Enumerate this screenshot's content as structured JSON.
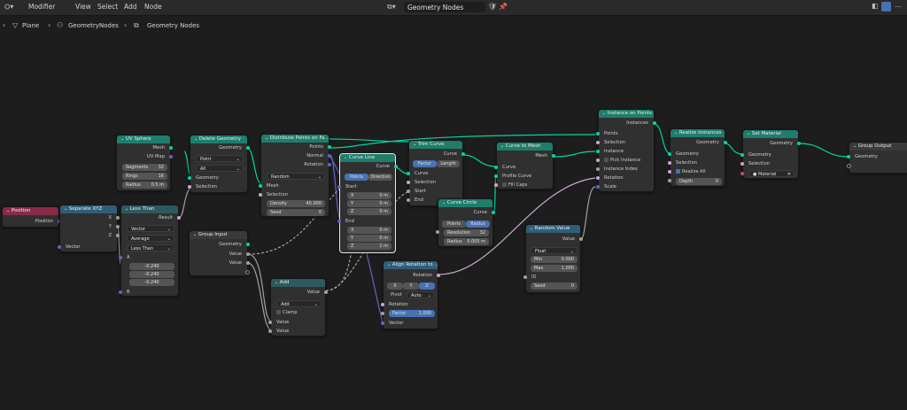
{
  "menu": {
    "modifier": "Modifier",
    "view": "View",
    "select": "Select",
    "add": "Add",
    "node": "Node"
  },
  "editor_title": "Geometry Nodes",
  "breadcrumb": {
    "plane": "Plane",
    "modifier": "GeometryNodes",
    "tree": "Geometry Nodes"
  },
  "nodes": {
    "position": {
      "title": "Position",
      "out": "Position"
    },
    "sepxyz": {
      "title": "Separate XYZ",
      "x": "X",
      "y": "Y",
      "z": "Z",
      "vector": "Vector"
    },
    "uvsphere": {
      "title": "UV Sphere",
      "mesh": "Mesh",
      "uvmap": "UV Map",
      "segments_l": "Segments",
      "segments": "32",
      "rings_l": "Rings",
      "rings": "16",
      "radius_l": "Radius",
      "radius": "0.5 m"
    },
    "lessthan": {
      "title": "Less Than",
      "result": "Result",
      "mode": "Vector",
      "op": "Average",
      "cmp": "Less Than",
      "a": "A",
      "a1": "-0.240",
      "a2": "-0.240",
      "a3": "-0.240",
      "b": "B"
    },
    "delgeo": {
      "title": "Delete Geometry",
      "geometry_out": "Geometry",
      "domain": "Point",
      "mode": "All",
      "geometry": "Geometry",
      "selection": "Selection"
    },
    "distribute": {
      "title": "Distribute Points on Fa…",
      "points": "Points",
      "normal": "Normal",
      "rotation": "Rotation",
      "method": "Random",
      "mesh": "Mesh",
      "selection": "Selection",
      "density_l": "Density",
      "density": "40.000",
      "seed_l": "Seed",
      "seed": "0"
    },
    "groupinput": {
      "title": "Group Input",
      "geometry": "Geometry",
      "value1": "Value",
      "value2": "Value"
    },
    "add": {
      "title": "Add",
      "value_out": "Value",
      "op": "Add",
      "clamp": "Clamp",
      "value1": "Value",
      "value2": "Value"
    },
    "curveline": {
      "title": "Curve Line",
      "curve": "Curve",
      "points": "Points",
      "direction": "Direction",
      "start": "Start",
      "sx": "X",
      "sxv": "0 m",
      "sy": "Y",
      "syv": "0 m",
      "sz": "Z",
      "szv": "0 m",
      "end": "End",
      "ex": "X",
      "exv": "0 m",
      "ey": "Y",
      "eyv": "0 m",
      "ez": "Z",
      "ezv": "1 m"
    },
    "trim": {
      "title": "Trim Curve",
      "curve_out": "Curve",
      "factor": "Factor",
      "length": "Length",
      "curve": "Curve",
      "selection": "Selection",
      "start": "Start",
      "end": "End"
    },
    "curvecircle": {
      "title": "Curve Circle",
      "curve": "Curve",
      "points": "Points",
      "radius_tab": "Radius",
      "res_l": "Resolution",
      "res": "32",
      "radius_l": "Radius",
      "radius": "0.005 m"
    },
    "curvetomesh": {
      "title": "Curve to Mesh",
      "mesh": "Mesh",
      "curve": "Curve",
      "profile": "Profile Curve",
      "fillcaps": "Fill Caps"
    },
    "align": {
      "title": "Align Rotation to …",
      "rotation_out": "Rotation",
      "x": "X",
      "y": "Y",
      "z": "Z",
      "pivot_l": "Pivot",
      "pivot": "Auto",
      "rotation": "Rotation",
      "factor_l": "Factor",
      "factor": "1.000",
      "vector": "Vector"
    },
    "random": {
      "title": "Random Value",
      "value": "Value",
      "type": "Float",
      "min_l": "Min",
      "min": "0.000",
      "max_l": "Max",
      "max": "1.000",
      "id": "ID",
      "seed_l": "Seed",
      "seed": "0"
    },
    "iop": {
      "title": "Instance on Points",
      "instances": "Instances",
      "points": "Points",
      "selection": "Selection",
      "instance": "Instance",
      "pick": "Pick Instance",
      "index": "Instance Index",
      "rotation": "Rotation",
      "scale": "Scale"
    },
    "realize": {
      "title": "Realize Instances",
      "geometry_out": "Geometry",
      "geometry": "Geometry",
      "selection": "Selection",
      "realize_all": "Realize All",
      "depth_l": "Depth",
      "depth": "0"
    },
    "setmat": {
      "title": "Set Material",
      "geometry_out": "Geometry",
      "geometry": "Geometry",
      "selection": "Selection",
      "material": "Material"
    },
    "groupoutput": {
      "title": "Group Output",
      "geometry": "Geometry"
    }
  },
  "colors": {
    "geometry_link": "#00d6a3",
    "vector_link": "#6363c7",
    "float_link": "#a1a1a1",
    "selected_outline": "#e8e8e8"
  }
}
